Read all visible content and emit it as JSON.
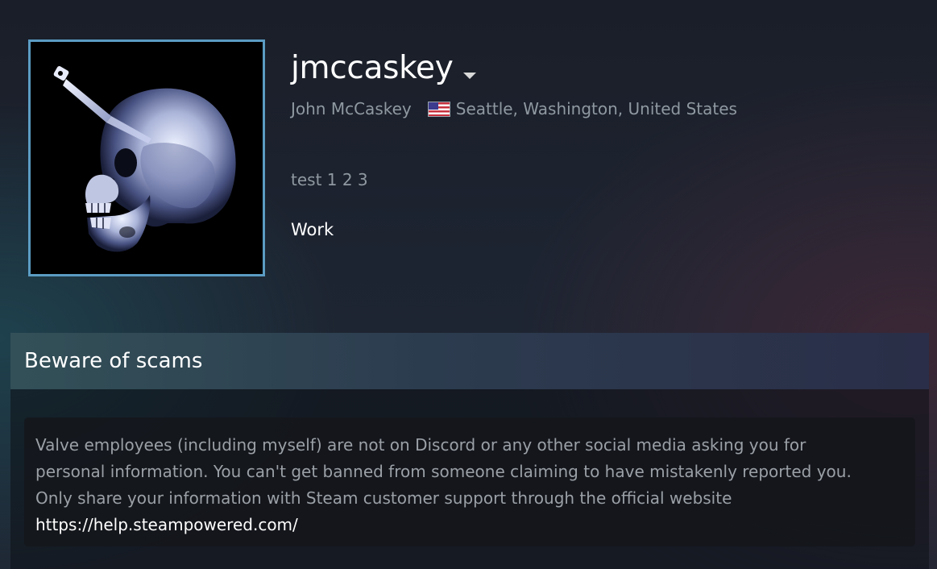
{
  "profile": {
    "persona_name": "jmccaskey",
    "real_name": "John McCaskey",
    "location": "Seattle, Washington, United States",
    "summary": "test 1 2 3",
    "featured_label": "Work",
    "avatar_icon": "skull-xray-avatar",
    "flag_icon": "us-flag-icon"
  },
  "showcase": {
    "title": "Beware of scams",
    "lines": [
      "Valve employees (including myself) are not on Discord or any other social media asking you for",
      "personal information. You can't get banned from someone claiming to have mistakenly reported you.",
      "Only share your information with Steam customer support through the official website"
    ],
    "link": "https://help.steampowered.com/"
  },
  "colors": {
    "avatar_border": "#5b9cc3",
    "muted_text": "#8f98a0",
    "white": "#ffffff"
  }
}
